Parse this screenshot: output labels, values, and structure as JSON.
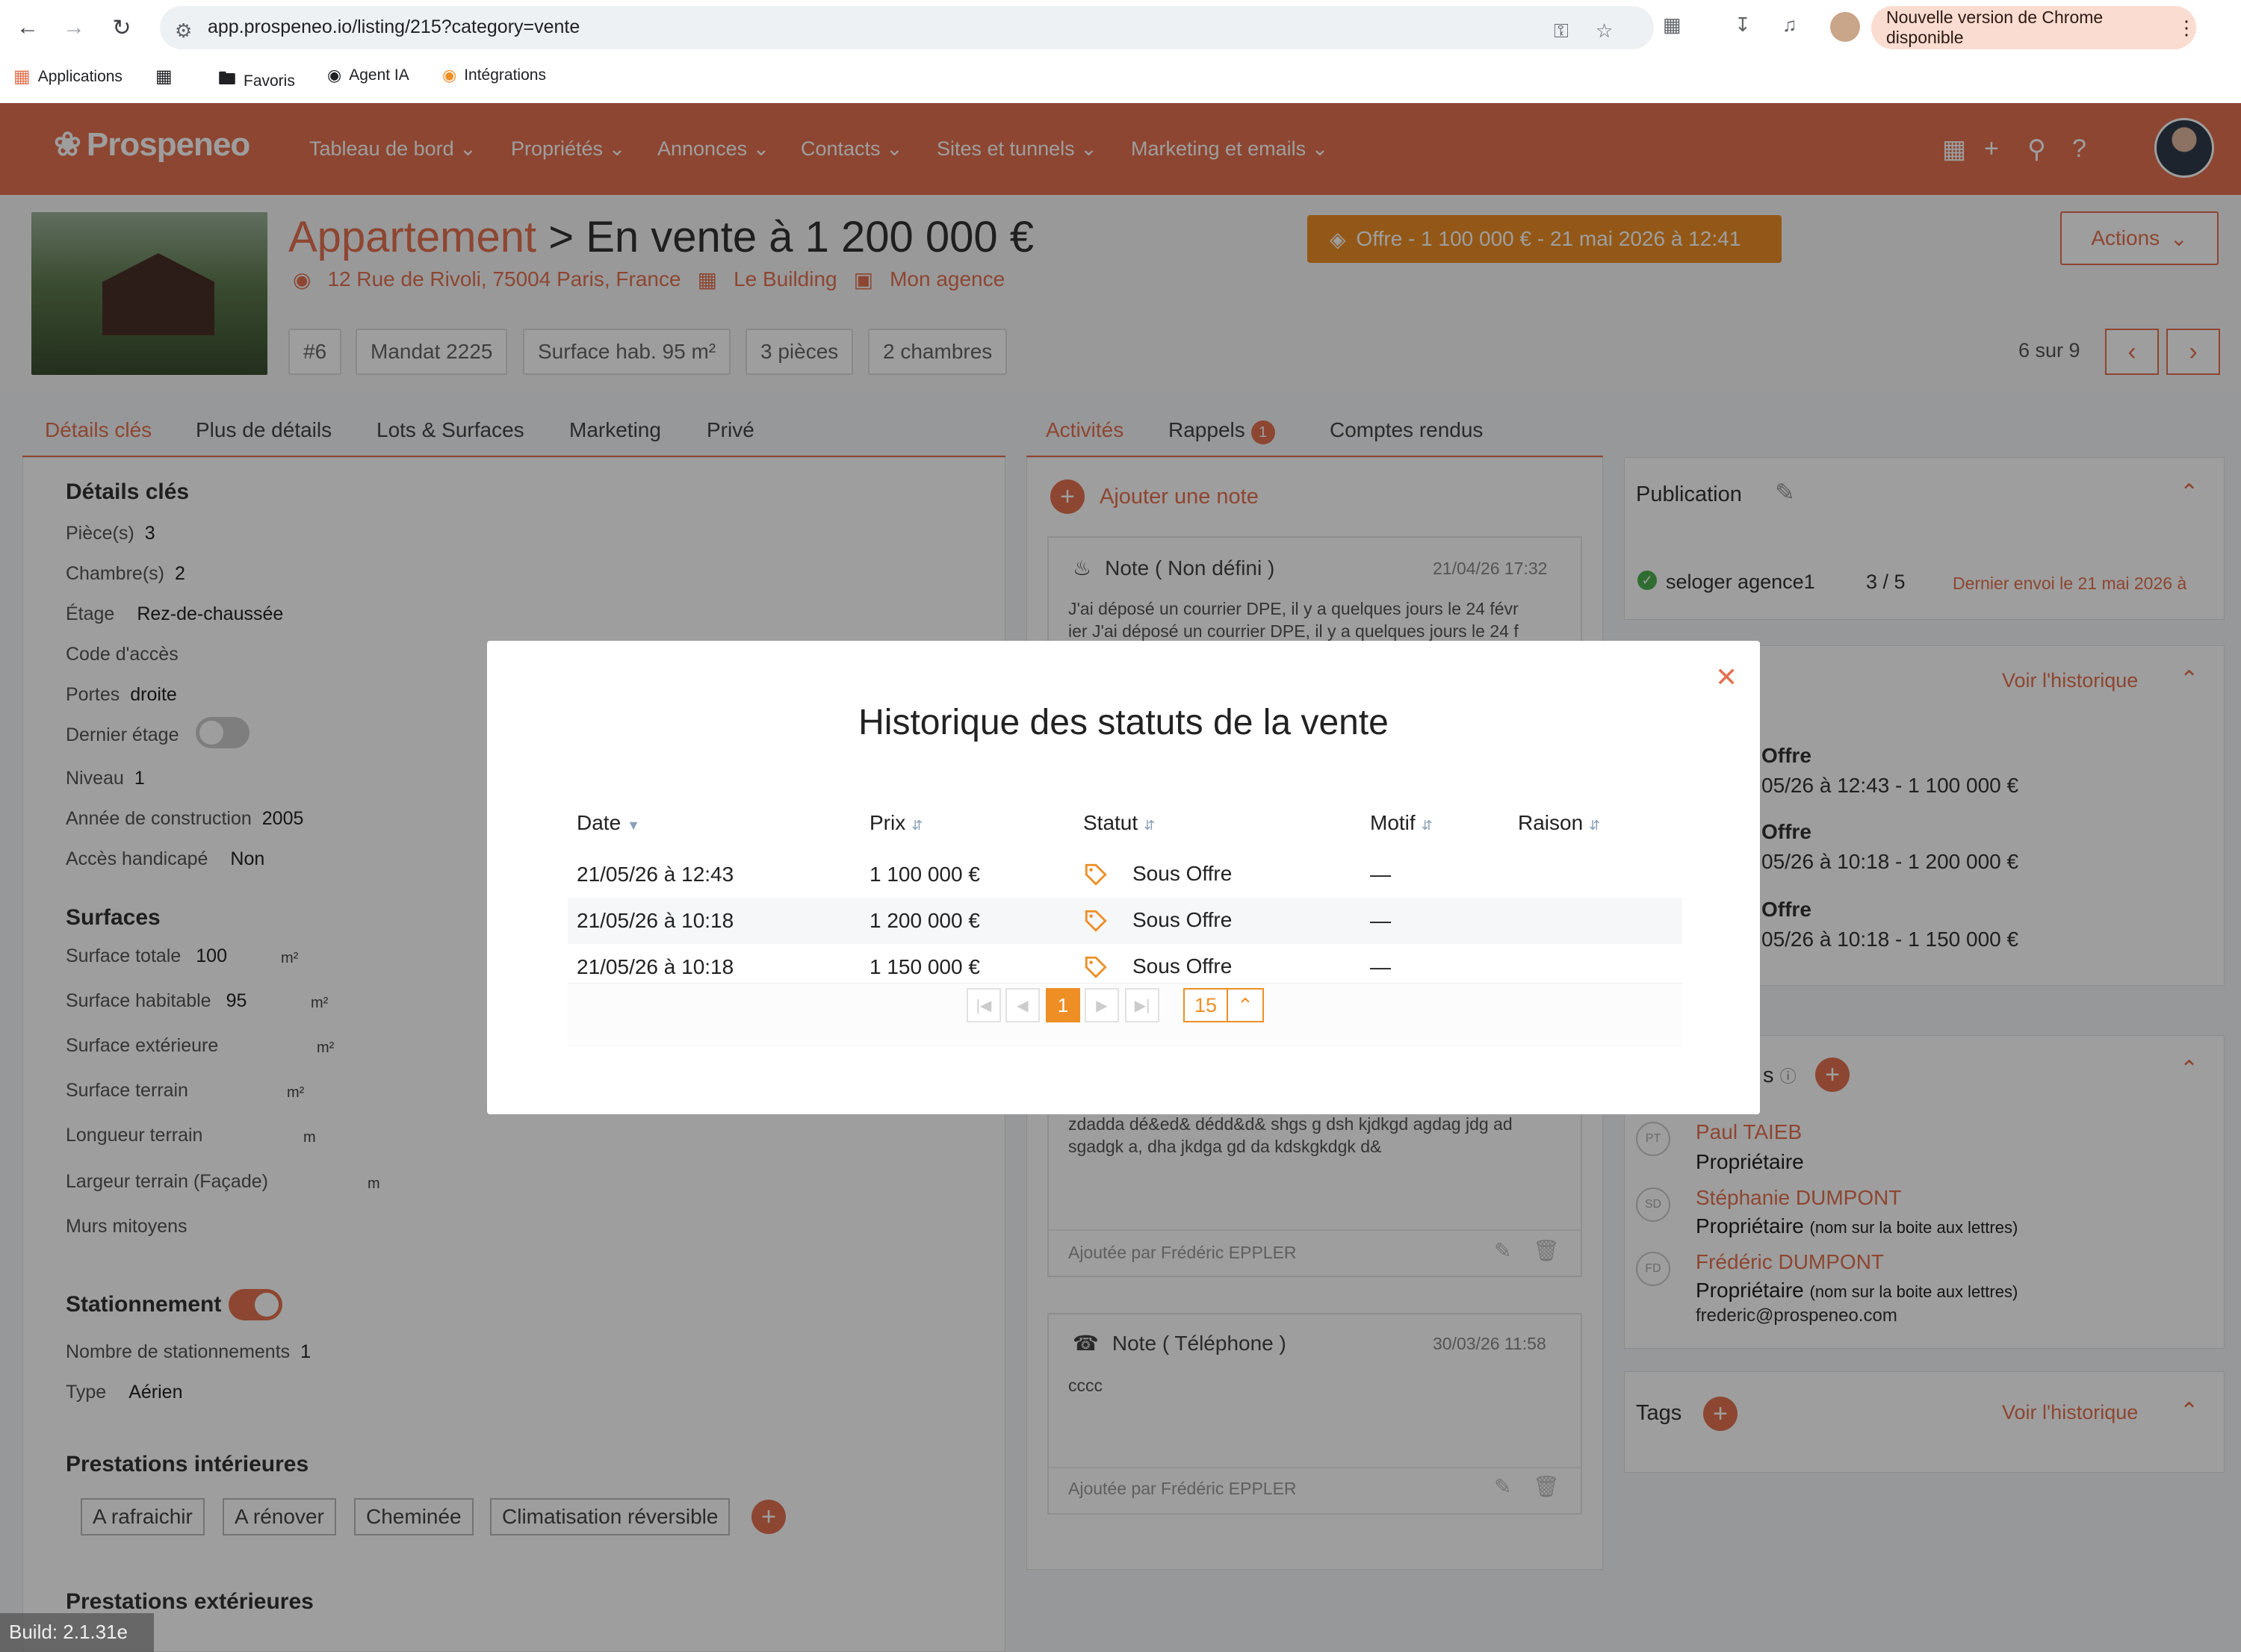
{
  "browser": {
    "url": "app.prospeneo.io/listing/215?category=vente",
    "update_pill": "Nouvelle version de Chrome disponible",
    "bookmarks": [
      "Applications",
      "Favoris",
      "Agent IA",
      "Intégrations"
    ]
  },
  "app": {
    "logo": "Prospeneo",
    "menu": [
      "Tableau de bord",
      "Propriétés",
      "Annonces",
      "Contacts",
      "Sites et tunnels",
      "Marketing et emails"
    ]
  },
  "listing": {
    "type": "Appartement",
    "title_rest": " > En vente à 1 200 000 €",
    "address": "12 Rue de Rivoli, 75004 Paris, France",
    "building": "Le Building",
    "agency": "Mon agence",
    "offer_badge": "Offre - 1 100 000 € - 21 mai 2026 à 12:41",
    "actions_label": "Actions",
    "chips": [
      "#6",
      "Mandat 2225",
      "Surface hab. 95 m²",
      "3 pièces",
      "2 chambres"
    ],
    "counter": "6 sur 9"
  },
  "left_tabs": [
    "Détails clés",
    "Plus de détails",
    "Lots & Surfaces",
    "Marketing",
    "Privé"
  ],
  "details": {
    "title": "Détails clés",
    "fields": [
      {
        "label": "Pièce(s)",
        "value": "3"
      },
      {
        "label": "Chambre(s)",
        "value": "2"
      },
      {
        "label": "Étage",
        "value": "Rez-de-chaussée"
      },
      {
        "label": "Code d'accès",
        "value": ""
      },
      {
        "label": "Portes",
        "value": "droite"
      },
      {
        "label": "Dernier étage",
        "value": ""
      },
      {
        "label": "Niveau",
        "value": "1"
      },
      {
        "label": "Année de construction",
        "value": "2005"
      },
      {
        "label": "Accès handicapé",
        "value": "Non"
      }
    ],
    "surfaces_title": "Surfaces",
    "surfaces": [
      {
        "label": "Surface totale",
        "value": "100",
        "unit": "m²"
      },
      {
        "label": "Surface habitable",
        "value": "95",
        "unit": "m²"
      },
      {
        "label": "Surface extérieure",
        "value": "",
        "unit": "m²"
      },
      {
        "label": "Surface terrain",
        "value": "",
        "unit": "m²"
      },
      {
        "label": "Longueur terrain",
        "value": "",
        "unit": "m"
      },
      {
        "label": "Largeur terrain (Façade)",
        "value": "",
        "unit": "m"
      },
      {
        "label": "Murs mitoyens",
        "value": "",
        "unit": ""
      }
    ],
    "parking_title": "Stationnement",
    "parking_count_label": "Nombre de stationnements",
    "parking_count": "1",
    "parking_type_label": "Type",
    "parking_type": "Aérien",
    "interior_title": "Prestations intérieures",
    "interior_tags": [
      "A rafraichir",
      "A rénover",
      "Cheminée",
      "Climatisation réversible"
    ],
    "exterior_title": "Prestations extérieures"
  },
  "mid_tabs": {
    "activities": "Activités",
    "reminders": "Rappels",
    "reminders_badge": "1",
    "reports": "Comptes rendus"
  },
  "notes": {
    "add_label": "Ajouter une note",
    "n1_title": "Note ( Non défini )",
    "n1_date": "21/04/26 17:32",
    "n1_line1": "J'ai déposé un courrier DPE, il y a quelques jours le 24 févr",
    "n1_line2": "ier J'ai déposé un courrier DPE, il y a quelques jours le 24 f",
    "n2_line1": "zdadda dé&ed& dédd&d& shgs g dsh kjdkgd agdag jdg ad",
    "n2_line2": "sgadgk a, dha jkdga gd da kdskgkdgk d&",
    "n2_added": "Ajoutée par Frédéric EPPLER",
    "n3_title": "Note ( Téléphone )",
    "n3_date": "30/03/26 11:58",
    "n3_body": "cccc",
    "n3_added": "Ajoutée par Frédéric EPPLER"
  },
  "right": {
    "publication_title": "Publication",
    "portal": "seloger agence1",
    "portal_ratio": "3 / 5",
    "portal_last": "Dernier envoi le 21 mai 2026 à",
    "history_link": "Voir l'historique",
    "history": [
      {
        "status": "Offre",
        "line": "05/26 à 12:43 - 1 100 000 €"
      },
      {
        "status": "Offre",
        "line": "05/26 à 10:18 - 1 200 000 €"
      },
      {
        "status": "Offre",
        "line": "05/26 à 10:18 - 1 150 000 €"
      }
    ],
    "contacts_title_frag": "s",
    "contacts": [
      {
        "initials": "PT",
        "name": "Paul TAIEB",
        "role": "Propriétaire",
        "note": "",
        "email": ""
      },
      {
        "initials": "SD",
        "name": "Stéphanie DUMPONT",
        "role": "Propriétaire",
        "note": "(nom sur la boite aux lettres)",
        "email": ""
      },
      {
        "initials": "FD",
        "name": "Frédéric DUMPONT",
        "role": "Propriétaire",
        "note": "(nom sur la boite aux lettres)",
        "email": "frederic@prospeneo.com"
      }
    ],
    "tags_title": "Tags",
    "tags_link": "Voir l'historique"
  },
  "modal": {
    "title": "Historique des statuts de la vente",
    "columns": [
      "Date",
      "Prix",
      "Statut",
      "Motif",
      "Raison"
    ],
    "rows": [
      {
        "date": "21/05/26 à 12:43",
        "price": "1 100 000 €",
        "status": "Sous Offre",
        "motif": "—",
        "raison": ""
      },
      {
        "date": "21/05/26 à 10:18",
        "price": "1 200 000 €",
        "status": "Sous Offre",
        "motif": "—",
        "raison": ""
      },
      {
        "date": "21/05/26 à 10:18",
        "price": "1 150 000 €",
        "status": "Sous Offre",
        "motif": "—",
        "raison": ""
      }
    ],
    "current_page": "1",
    "page_size": "15"
  },
  "build": "Build: 2.1.31e",
  "colors": {
    "accent": "#e4714f",
    "offer": "#ee8f26"
  }
}
